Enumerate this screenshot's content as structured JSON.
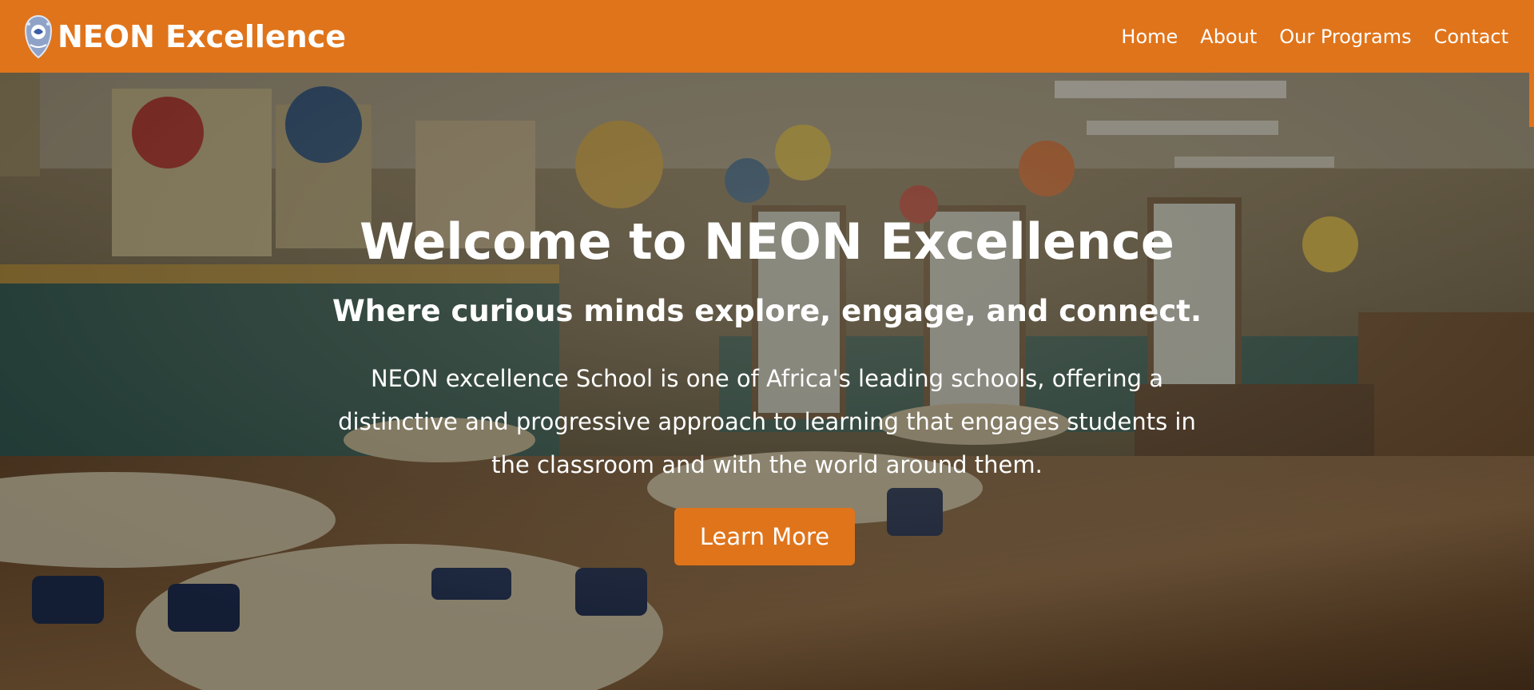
{
  "navbar": {
    "brand": "NEON Excellence",
    "logo_icon": "school-crest-icon",
    "links": [
      "Home",
      "About",
      "Our Programs",
      "Contact"
    ],
    "bg_color": "#e0741b"
  },
  "hero": {
    "background": "classroom-photo",
    "title": "Welcome to NEON Excellence",
    "subtitle": "Where curious minds explore, engage, and connect.",
    "description": "NEON excellence School is one of Africa's leading schools, offering a distinctive and progressive approach to learning that engages students in the classroom and with the world around them.",
    "cta_label": "Learn More",
    "cta_color": "#e0741b"
  }
}
